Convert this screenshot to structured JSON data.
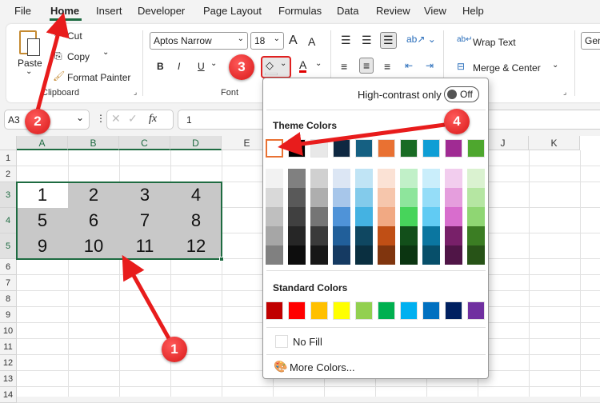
{
  "menu": {
    "tabs": [
      "File",
      "Home",
      "Insert",
      "Developer",
      "Page Layout",
      "Formulas",
      "Data",
      "Review",
      "View",
      "Help"
    ],
    "active": "Home"
  },
  "ribbon": {
    "clipboard": {
      "paste": "Paste",
      "cut": "Cut",
      "copy": "Copy",
      "format_painter": "Format Painter",
      "group": "Clipboard"
    },
    "font": {
      "name": "Aptos Narrow",
      "size": "18",
      "bold": "B",
      "italic": "I",
      "underline": "U",
      "font_color_letter": "A",
      "grow": "A",
      "shrink": "A",
      "group": "Font"
    },
    "alignment": {
      "wrap_text": "Wrap Text",
      "merge_center": "Merge & Center"
    },
    "number": {
      "format": "Gen"
    }
  },
  "formula_bar": {
    "name_box": "A3",
    "fx": "fx",
    "value": "1"
  },
  "sheet": {
    "columns": [
      "A",
      "B",
      "C",
      "D",
      "E",
      "F",
      "G",
      "H",
      "I",
      "J",
      "K"
    ],
    "rows": [
      "1",
      "2",
      "3",
      "4",
      "5",
      "6",
      "7",
      "8",
      "9",
      "10",
      "11",
      "12",
      "13",
      "14"
    ],
    "cells": [
      [
        "1",
        "2",
        "3",
        "4"
      ],
      [
        "5",
        "6",
        "7",
        "8"
      ],
      [
        "9",
        "10",
        "11",
        "12"
      ]
    ],
    "fill_color": "#c8c8c8",
    "selection_color": "#1e6b41"
  },
  "fill_menu": {
    "high_contrast_label": "High-contrast only",
    "toggle": "Off",
    "theme_title": "Theme Colors",
    "theme_colors": [
      "#ffffff",
      "#000000",
      "#e8e8e8",
      "#0e2841",
      "#156082",
      "#e97132",
      "#196b24",
      "#0f9ed5",
      "#a02b93",
      "#4ea72e"
    ],
    "theme_shades": [
      [
        "#f2f2f2",
        "#d9d9d9",
        "#bfbfbf",
        "#a6a6a6",
        "#808080"
      ],
      [
        "#808080",
        "#595959",
        "#404040",
        "#262626",
        "#0d0d0d"
      ],
      [
        "#d0d0d0",
        "#aeaeae",
        "#757575",
        "#3a3a3a",
        "#171717"
      ],
      [
        "#dce6f4",
        "#a7c6ea",
        "#4f93d8",
        "#215f9a",
        "#153a62"
      ],
      [
        "#c0e4f5",
        "#83cbeb",
        "#44b2e2",
        "#0f4761",
        "#0a2f40"
      ],
      [
        "#fbe2d5",
        "#f6c6ac",
        "#f1a983",
        "#c04f15",
        "#80350e"
      ],
      [
        "#c1f0c8",
        "#8ee59c",
        "#47d45b",
        "#124f1a",
        "#0b3511"
      ],
      [
        "#caeefb",
        "#95ddf8",
        "#61cbf3",
        "#0b76a0",
        "#074f6a"
      ],
      [
        "#f2cdee",
        "#e59edd",
        "#d86dcd",
        "#782069",
        "#501547"
      ],
      [
        "#daf2d0",
        "#b5e6a2",
        "#8fd673",
        "#3b7d23",
        "#275317"
      ]
    ],
    "standard_title": "Standard Colors",
    "standard_colors": [
      "#c00000",
      "#ff0000",
      "#ffc000",
      "#ffff00",
      "#92d050",
      "#00b050",
      "#00b0f0",
      "#0070c0",
      "#002060",
      "#7030a0"
    ],
    "no_fill": "No Fill",
    "more_colors": "More Colors..."
  },
  "annotations": {
    "labels": [
      "1",
      "2",
      "3",
      "4"
    ],
    "color": "#e81c1c"
  }
}
